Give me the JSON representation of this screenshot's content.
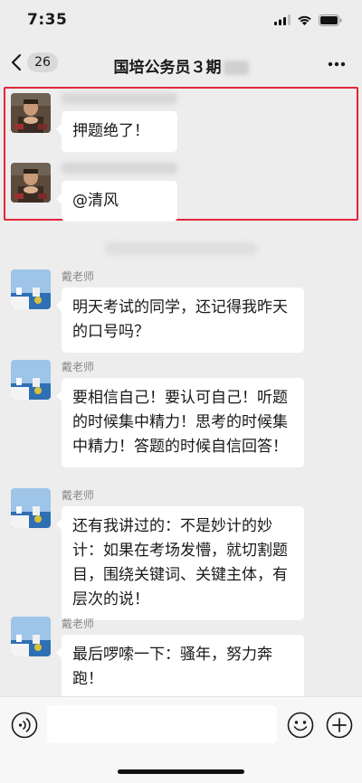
{
  "status_bar": {
    "time": "7:35"
  },
  "nav": {
    "back_label": "<",
    "unread_count": "26",
    "title": "国培公务员３期"
  },
  "messages": [
    {
      "sender": "",
      "text": "押题绝了！"
    },
    {
      "sender": "",
      "text": "@清风"
    },
    {
      "sender": "戴老师",
      "text": "明天考试的同学，还记得我昨天的口号吗？"
    },
    {
      "sender": "戴老师",
      "text": "要相信自己！要认可自己！听题的时候集中精力！思考的时候集中精力！答题的时候自信回答！"
    },
    {
      "sender": "戴老师",
      "text": "还有我讲过的：不是妙计的妙计：如果在考场发懵，就切割题目，围绕关键词、关键主体，有层次的说！"
    },
    {
      "sender": "戴老师",
      "text": "最后啰嗦一下：骚年，努力奔跑！"
    }
  ],
  "input_bar": {
    "placeholder": ""
  },
  "colors": {
    "highlight": "#e0263a",
    "background": "#ededed",
    "bubble": "#ffffff"
  }
}
